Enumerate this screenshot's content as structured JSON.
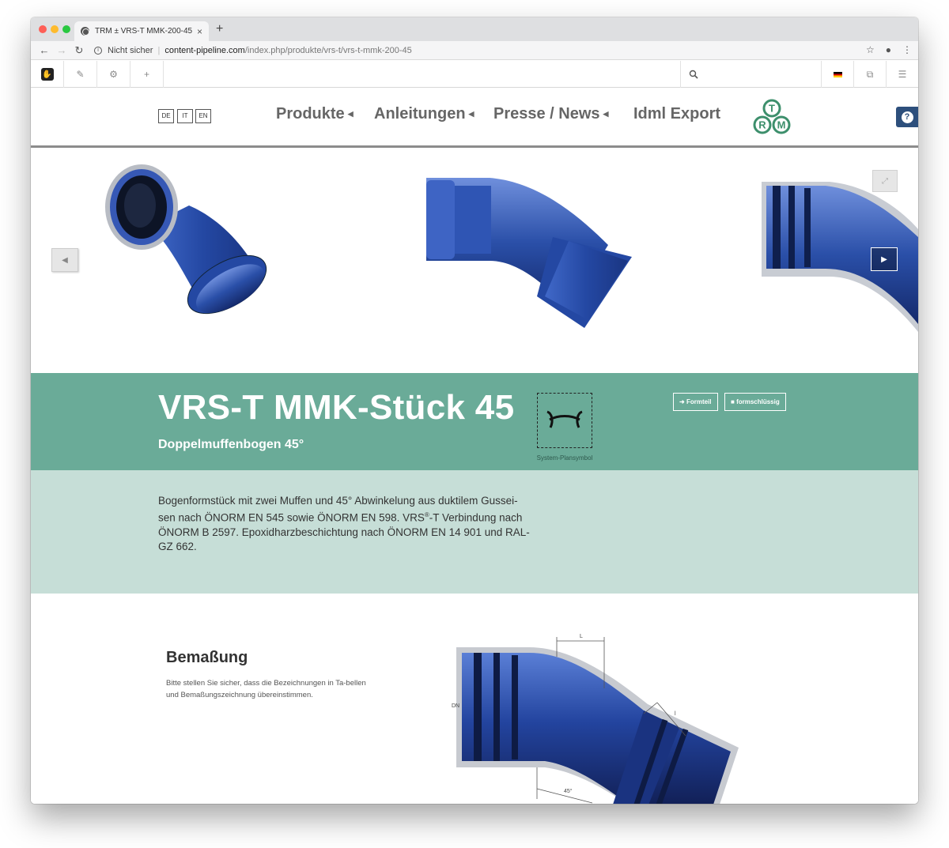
{
  "browser": {
    "tab_title": "TRM ± VRS-T MMK-200-45",
    "tab_close": "×",
    "new_tab": "+",
    "url_security": "Nicht sicher",
    "url_host": "content-pipeline.com",
    "url_path": "/index.php/produkte/vrs-t/vrs-t-mmk-200-45"
  },
  "languages": [
    "DE",
    "IT",
    "EN"
  ],
  "nav": {
    "produkte": "Produkte",
    "anleitungen": "Anleitungen",
    "presse": "Presse / News",
    "idml": "Idml Export"
  },
  "logo_letters": [
    "T",
    "R",
    "M"
  ],
  "help_label": "?",
  "product": {
    "title": "VRS-T MMK-Stück 45",
    "subtitle": "Doppelmuffenbogen 45°",
    "symbol_label": "System-Plansymbol",
    "badge_formteil": "Formteil",
    "badge_formschluessig": "formschlüssig",
    "description_1": "Bogenformstück mit zwei Muffen und 45° Abwinkelung aus duktilem Gussei-sen nach ÖNORM EN 545 sowie ÖNORM EN 598. VRS",
    "description_sup": "®",
    "description_2": "-T Verbindung nach ÖNORM B 2597. Epoxidharzbeschichtung nach ÖNORM EN 14 901 und RAL-GZ 662."
  },
  "dimensions": {
    "title": "Bemaßung",
    "text": "Bitte stellen Sie sicher, dass die Bezeichnungen in Ta-bellen und Bemaßungszeichnung übereinstimmen.",
    "label_L": "L",
    "label_l": "l",
    "label_DN": "DN",
    "label_angle": "45°"
  },
  "colors": {
    "band_green": "#6aab98",
    "desc_green": "#c6ded7",
    "pipe_blue": "#2a4fa8",
    "help_blue": "#2d4f7c"
  },
  "icons": [
    "globe-icon",
    "back-icon",
    "forward-icon",
    "reload-icon",
    "info-icon",
    "star-icon",
    "account-icon",
    "menu-icon",
    "pencil-icon",
    "gear-icon",
    "plus-icon",
    "search-icon",
    "flag-de-icon",
    "copy-icon",
    "sliders-icon",
    "prev-arrow-icon",
    "next-arrow-icon",
    "expand-icon",
    "help-icon"
  ]
}
